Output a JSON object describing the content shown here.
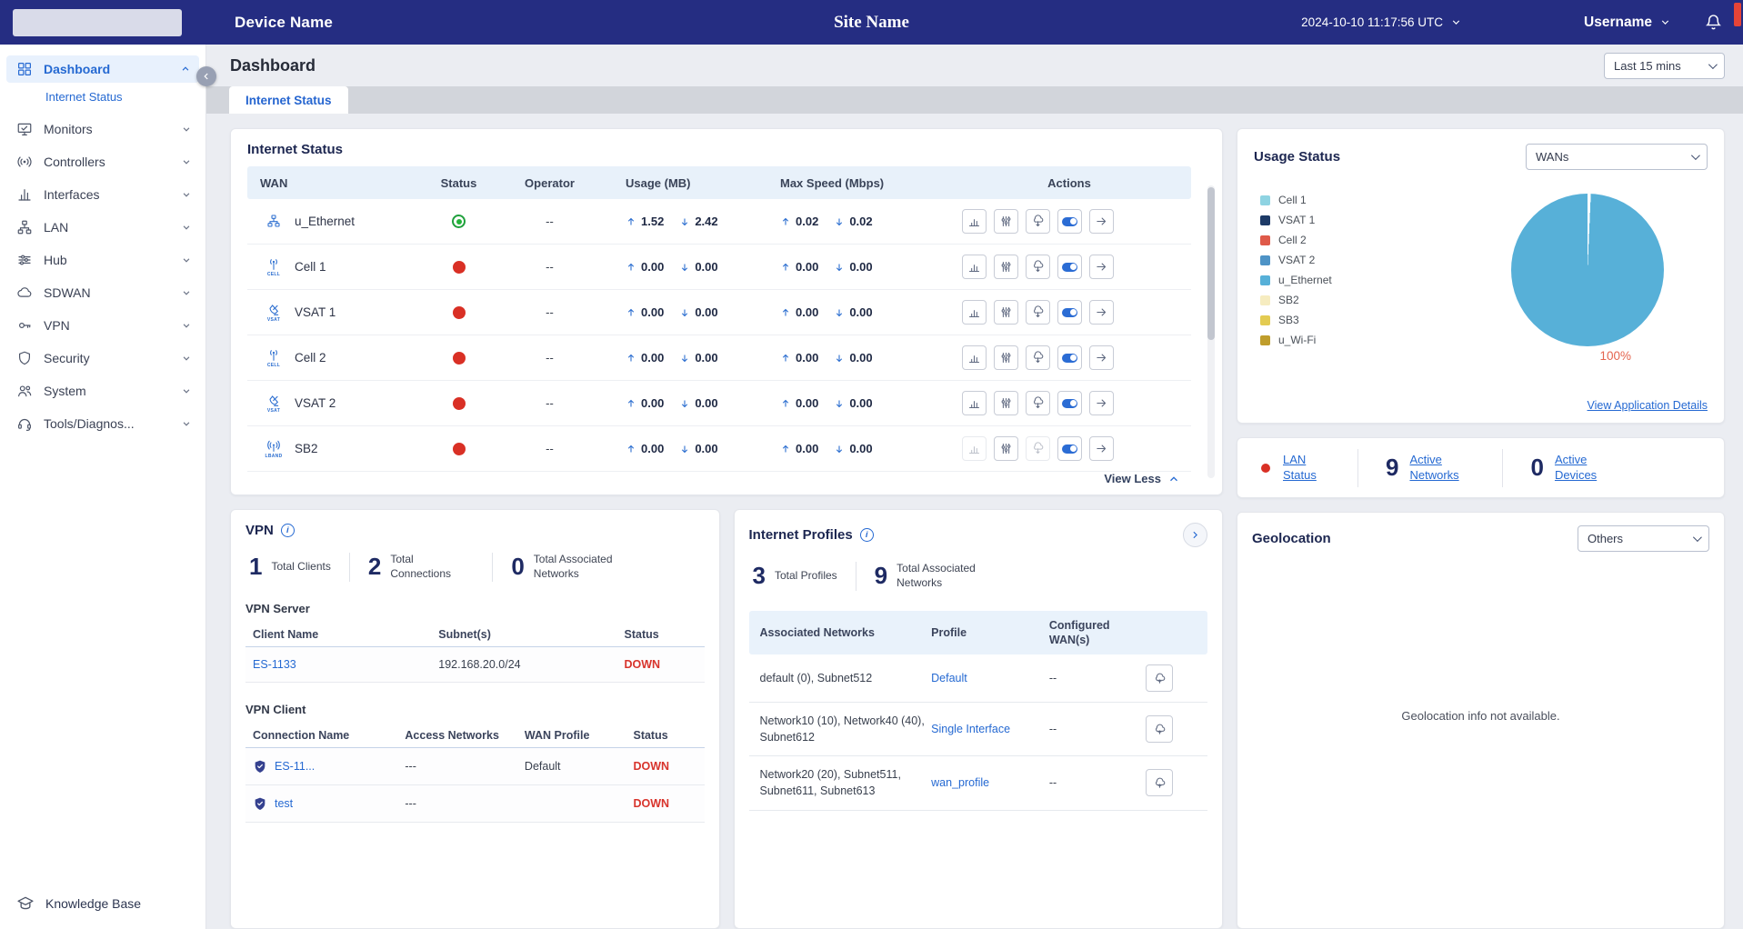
{
  "topbar": {
    "device_name": "Device Name",
    "site_name": "Site Name",
    "datetime": "2024-10-10 11:17:56 UTC",
    "username": "Username"
  },
  "sidebar": {
    "items": [
      {
        "label": "Dashboard"
      },
      {
        "label": "Internet Status"
      },
      {
        "label": "Monitors"
      },
      {
        "label": "Controllers"
      },
      {
        "label": "Interfaces"
      },
      {
        "label": "LAN"
      },
      {
        "label": "Hub"
      },
      {
        "label": "SDWAN"
      },
      {
        "label": "VPN"
      },
      {
        "label": "Security"
      },
      {
        "label": "System"
      },
      {
        "label": "Tools/Diagnos..."
      }
    ],
    "footer_label": "Knowledge Base"
  },
  "page": {
    "title": "Dashboard",
    "time_range": "Last 15 mins",
    "tab": "Internet Status"
  },
  "internet_status": {
    "title": "Internet Status",
    "columns": [
      "WAN",
      "Status",
      "Operator",
      "Usage (MB)",
      "Max Speed (Mbps)",
      "Actions"
    ],
    "view_toggle": "View Less",
    "rows": [
      {
        "name": "u_Ethernet",
        "type_label": "",
        "status": "up",
        "operator": "--",
        "usage_up": "1.52",
        "usage_down": "2.42",
        "max_up": "0.02",
        "max_down": "0.02"
      },
      {
        "name": "Cell 1",
        "type_label": "CELL",
        "status": "down",
        "operator": "--",
        "usage_up": "0.00",
        "usage_down": "0.00",
        "max_up": "0.00",
        "max_down": "0.00"
      },
      {
        "name": "VSAT 1",
        "type_label": "VSAT",
        "status": "down",
        "operator": "--",
        "usage_up": "0.00",
        "usage_down": "0.00",
        "max_up": "0.00",
        "max_down": "0.00"
      },
      {
        "name": "Cell 2",
        "type_label": "CELL",
        "status": "down",
        "operator": "--",
        "usage_up": "0.00",
        "usage_down": "0.00",
        "max_up": "0.00",
        "max_down": "0.00"
      },
      {
        "name": "VSAT 2",
        "type_label": "VSAT",
        "status": "down",
        "operator": "--",
        "usage_up": "0.00",
        "usage_down": "0.00",
        "max_up": "0.00",
        "max_down": "0.00"
      },
      {
        "name": "SB2",
        "type_label": "LBAND",
        "status": "down",
        "operator": "--",
        "usage_up": "0.00",
        "usage_down": "0.00",
        "max_up": "0.00",
        "max_down": "0.00"
      }
    ]
  },
  "usage_status": {
    "title": "Usage Status",
    "wan_selector": "WANs",
    "legend": [
      {
        "label": "Cell 1",
        "color": "#8ed3e2"
      },
      {
        "label": "VSAT 1",
        "color": "#1d3a66"
      },
      {
        "label": "Cell 2",
        "color": "#df5a49"
      },
      {
        "label": "VSAT 2",
        "color": "#4e93c6"
      },
      {
        "label": "u_Ethernet",
        "color": "#57b0d8"
      },
      {
        "label": "SB2",
        "color": "#f6ecc0"
      },
      {
        "label": "SB3",
        "color": "#e3cb52"
      },
      {
        "label": "u_Wi-Fi",
        "color": "#bf9d2c"
      }
    ],
    "pie": {
      "type": "pie",
      "labels": [
        "u_Ethernet"
      ],
      "values": [
        100
      ],
      "value_label": "100%",
      "slice_color": "#57b0d8",
      "label_color": "#e4654f"
    },
    "details_link": "View Application Details"
  },
  "lan_status": {
    "dot_color": "#d93025",
    "status_label": "LAN Status",
    "stats": [
      {
        "value": "9",
        "label": "Active Networks"
      },
      {
        "value": "0",
        "label": "Active Devices"
      }
    ]
  },
  "vpn": {
    "title": "VPN",
    "stats": [
      {
        "value": "1",
        "label": "Total Clients"
      },
      {
        "value": "2",
        "label": "Total Connections"
      },
      {
        "value": "0",
        "label": "Total Associated Networks"
      }
    ],
    "server": {
      "heading": "VPN Server",
      "columns": [
        "Client Name",
        "Subnet(s)",
        "Status"
      ],
      "rows": [
        {
          "client": "ES-1133",
          "subnets": "192.168.20.0/24",
          "status": "DOWN"
        }
      ]
    },
    "client": {
      "heading": "VPN Client",
      "columns": [
        "Connection Name",
        "Access Networks",
        "WAN Profile",
        "Status"
      ],
      "rows": [
        {
          "name": "ES-11...",
          "access": "---",
          "profile": "Default",
          "status": "DOWN"
        },
        {
          "name": "test",
          "access": "---",
          "profile": "",
          "status": "DOWN"
        }
      ]
    }
  },
  "internet_profiles": {
    "title": "Internet Profiles",
    "stats": [
      {
        "value": "3",
        "label": "Total Profiles"
      },
      {
        "value": "9",
        "label": "Total Associated Networks"
      }
    ],
    "columns": [
      "Associated Networks",
      "Profile",
      "Configured WAN(s)"
    ],
    "rows": [
      {
        "networks": "default (0), Subnet512",
        "profile": "Default",
        "wans": "--"
      },
      {
        "networks": "Network10 (10), Network40 (40), Subnet612",
        "profile": "Single Interface",
        "wans": "--"
      },
      {
        "networks": "Network20 (20), Subnet511, Subnet611, Subnet613",
        "profile": "wan_profile",
        "wans": "--"
      }
    ]
  },
  "geolocation": {
    "title": "Geolocation",
    "selector_value": "Others",
    "message": "Geolocation info not available."
  }
}
